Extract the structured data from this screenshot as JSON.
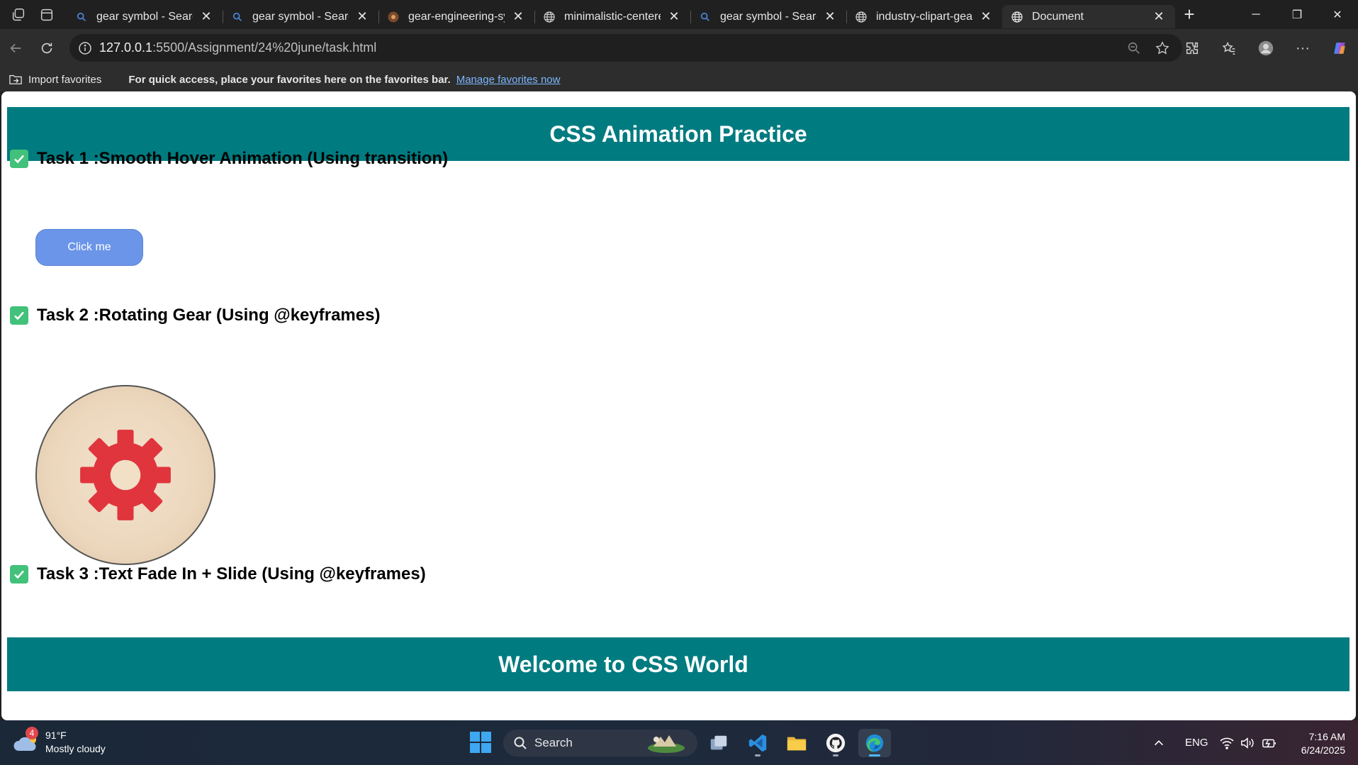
{
  "browser": {
    "tabs": [
      {
        "title": "gear symbol - Search",
        "favicon": "search-icon"
      },
      {
        "title": "gear symbol - Search",
        "favicon": "search-icon"
      },
      {
        "title": "gear-engineering-sym",
        "favicon": "image-icon"
      },
      {
        "title": "minimalistic-centered",
        "favicon": "globe-icon"
      },
      {
        "title": "gear symbol - Search",
        "favicon": "search-icon"
      },
      {
        "title": "industry-clipart-gear-",
        "favicon": "globe-icon"
      },
      {
        "title": "Document",
        "favicon": "globe-icon",
        "active": true
      }
    ],
    "url_host": "127.0.0.1",
    "url_rest": ":5500/Assignment/24%20june/task.html",
    "favorites": {
      "import_label": "Import favorites",
      "message": "For quick access, place your favorites here on the favorites bar.",
      "link": "Manage favorites now"
    }
  },
  "page": {
    "header": "CSS Animation Practice",
    "tasks": [
      {
        "label": "Task 1 :",
        "name": "Smooth Hover Animation (Using transition)"
      },
      {
        "label": "Task 2 :",
        "name": "Rotating Gear (Using @keyframes)"
      },
      {
        "label": "Task 3 :",
        "name": "Text Fade In + Slide (Using @keyframes)"
      }
    ],
    "button_label": "Click me",
    "footer": "Welcome to CSS World",
    "colors": {
      "banner": "#007b80",
      "button": "#6b95e8",
      "gear": "#e0353d",
      "check": "#42c17a"
    }
  },
  "taskbar": {
    "weather_badge": "4",
    "temperature": "91°F",
    "condition": "Mostly cloudy",
    "search_placeholder": "Search",
    "language": "ENG",
    "time": "7:16 AM",
    "date": "6/24/2025"
  }
}
